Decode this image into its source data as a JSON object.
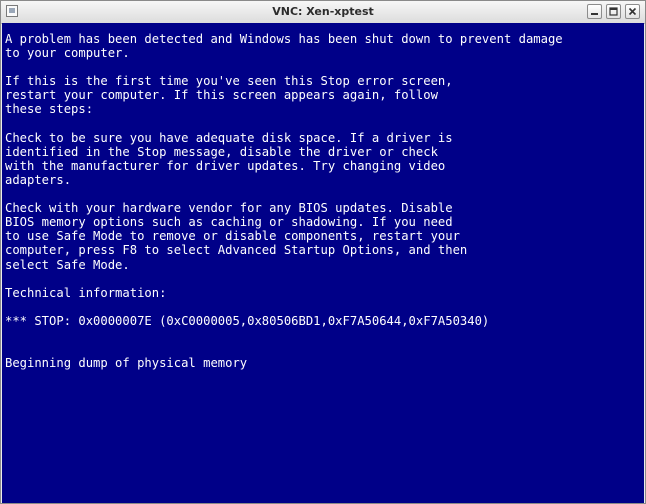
{
  "window": {
    "title": "VNC: Xen-xptest",
    "icons": {
      "app": "window-icon",
      "minimize": "minimize-icon",
      "maximize": "maximize-icon",
      "close": "close-icon"
    }
  },
  "screen": {
    "background": "#000088",
    "text_color": "#ffffff",
    "lines": [
      "A problem has been detected and Windows has been shut down to prevent damage",
      "to your computer.",
      "",
      "If this is the first time you've seen this Stop error screen,",
      "restart your computer. If this screen appears again, follow",
      "these steps:",
      "",
      "Check to be sure you have adequate disk space. If a driver is",
      "identified in the Stop message, disable the driver or check",
      "with the manufacturer for driver updates. Try changing video",
      "adapters.",
      "",
      "Check with your hardware vendor for any BIOS updates. Disable",
      "BIOS memory options such as caching or shadowing. If you need",
      "to use Safe Mode to remove or disable components, restart your",
      "computer, press F8 to select Advanced Startup Options, and then",
      "select Safe Mode.",
      "",
      "Technical information:",
      "",
      "*** STOP: 0x0000007E (0xC0000005,0x80506BD1,0xF7A50644,0xF7A50340)",
      "",
      "",
      "Beginning dump of physical memory"
    ]
  }
}
